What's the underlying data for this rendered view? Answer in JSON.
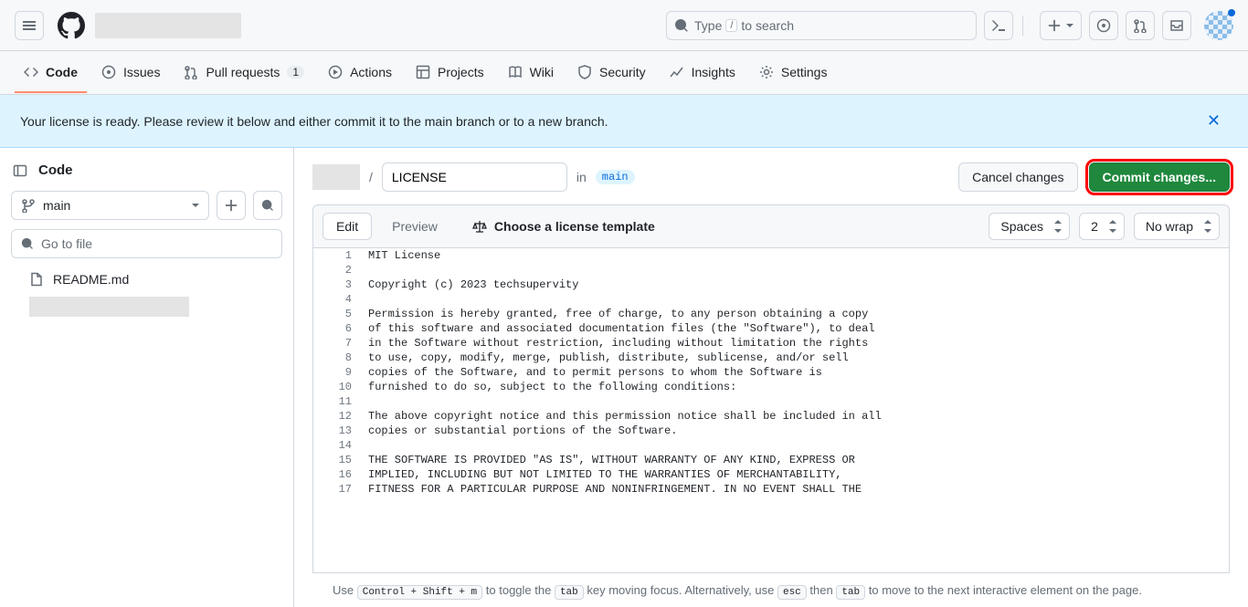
{
  "header": {
    "search_placeholder": "Type / to search",
    "search_leading": "Type",
    "search_trailing": "to search",
    "slash_key": "/"
  },
  "nav": {
    "tabs": [
      {
        "label": "Code"
      },
      {
        "label": "Issues"
      },
      {
        "label": "Pull requests",
        "count": "1"
      },
      {
        "label": "Actions"
      },
      {
        "label": "Projects"
      },
      {
        "label": "Wiki"
      },
      {
        "label": "Security"
      },
      {
        "label": "Insights"
      },
      {
        "label": "Settings"
      }
    ]
  },
  "notice": {
    "text": "Your license is ready. Please review it below and either commit it to the main branch or to a new branch."
  },
  "sidebar": {
    "title": "Code",
    "branch": "main",
    "file_filter_placeholder": "Go to file",
    "files": [
      {
        "name": "README.md"
      }
    ]
  },
  "pathbar": {
    "filename": "LICENSE",
    "in_text": "in",
    "branch": "main",
    "cancel_label": "Cancel changes",
    "commit_label": "Commit changes..."
  },
  "editbar": {
    "edit_tab": "Edit",
    "preview_tab": "Preview",
    "license_template": "Choose a license template",
    "indent_mode": "Spaces",
    "indent_size": "2",
    "wrap_mode": "No wrap"
  },
  "editor": {
    "lines": [
      "MIT License",
      "",
      "Copyright (c) 2023 techsupervity",
      "",
      "Permission is hereby granted, free of charge, to any person obtaining a copy",
      "of this software and associated documentation files (the \"Software\"), to deal",
      "in the Software without restriction, including without limitation the rights",
      "to use, copy, modify, merge, publish, distribute, sublicense, and/or sell",
      "copies of the Software, and to permit persons to whom the Software is",
      "furnished to do so, subject to the following conditions:",
      "",
      "The above copyright notice and this permission notice shall be included in all",
      "copies or substantial portions of the Software.",
      "",
      "THE SOFTWARE IS PROVIDED \"AS IS\", WITHOUT WARRANTY OF ANY KIND, EXPRESS OR",
      "IMPLIED, INCLUDING BUT NOT LIMITED TO THE WARRANTIES OF MERCHANTABILITY,",
      "FITNESS FOR A PARTICULAR PURPOSE AND NONINFRINGEMENT. IN NO EVENT SHALL THE"
    ]
  },
  "hint": {
    "pre": "Use ",
    "k1": "Control + Shift + m",
    "mid1": " to toggle the ",
    "k2": "tab",
    "mid2": " key moving focus. Alternatively, use ",
    "k3": "esc",
    "mid3": " then ",
    "k4": "tab",
    "post": " to move to the next interactive element on the page."
  }
}
